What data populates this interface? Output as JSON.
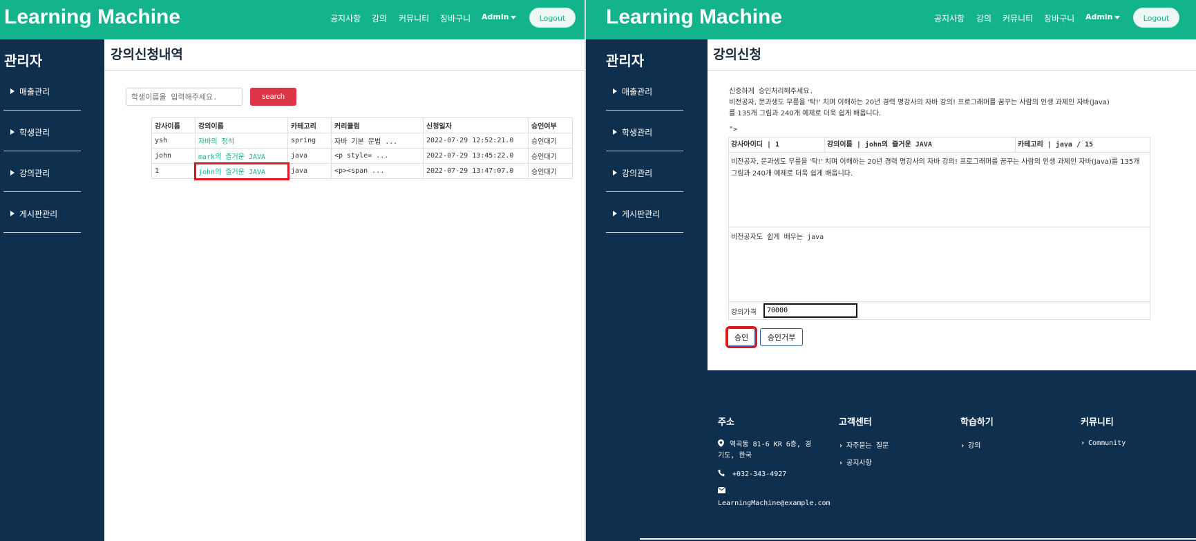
{
  "nav": {
    "brand": "Learning Machine",
    "items": [
      "공지사항",
      "강의",
      "커뮤니티",
      "장바구니"
    ],
    "admin": "Admin",
    "logout": "Logout"
  },
  "sidebar": {
    "title": "관리자",
    "items": [
      "매출관리",
      "학생관리",
      "강의관리",
      "게시판관리"
    ]
  },
  "left": {
    "page_title": "강의신청내역",
    "search_placeholder": "학생이름을 입력해주세요.",
    "search_button": "search",
    "table": {
      "headers": [
        "강사이름",
        "강의이름",
        "카테고리",
        "커리큘럼",
        "신청일자",
        "승인여부"
      ],
      "rows": [
        [
          "ysh",
          "자바의 정석",
          "spring",
          "자바 기본 문법 ...",
          "2022-07-29 12:52:21.0",
          "승인대기"
        ],
        [
          "john",
          "mark의 즐거운 JAVA",
          "java",
          "<p style= ...",
          "2022-07-29 13:45:22.0",
          "승인대기"
        ],
        [
          "1",
          "john의 즐거운 JAVA",
          "java",
          "<p><span ...",
          "2022-07-29 13:47:07.0",
          "승인대기"
        ]
      ]
    }
  },
  "right": {
    "page_title": "강의신청",
    "intro1": "신중하게 승인처리해주세요.",
    "intro2": "비전공자, 문과생도 무릎을 '탁!' 치며 이해하는 20년 경력 명강사의 자바 강의! 프로그래머를 꿈꾸는 사람의 인생 과제인 자바(Java)",
    "intro3": "를 135개 그림과 240개 예제로 더욱 쉽게 배웁니다.",
    "stray": "\">",
    "header_cells": [
      "강사아이디 | 1",
      "강의이름 | john의 즐거운 JAVA",
      "카테고리 | java / 15"
    ],
    "body_text": "비전공자, 문과생도 무릎을 '탁!' 치며 이해하는 20년 경력 명강사의 자바 강의! 프로그래머를 꿈꾸는 사람의 인생 과제인 자바(Java)를 135개 그림과 240개 예제로 더욱 쉽게 배웁니다.",
    "summary": "비전공자도 쉽게 배우는 java",
    "price_label": "강의가격",
    "price_value": "70000",
    "approve": "승인",
    "reject": "승인거부"
  },
  "footer": {
    "columns": [
      {
        "title": "주소",
        "items": [
          "역곡동 81-6 KR 6층, 경",
          "기도, 한국",
          "+032-343-4927",
          "LearningMachine@example.com"
        ]
      },
      {
        "title": "고객센터",
        "items": [
          "자주묻는 질문",
          "공지사항"
        ]
      },
      {
        "title": "학습하기",
        "items": [
          "강의"
        ]
      },
      {
        "title": "커뮤니티",
        "items": [
          "Community"
        ]
      }
    ]
  }
}
